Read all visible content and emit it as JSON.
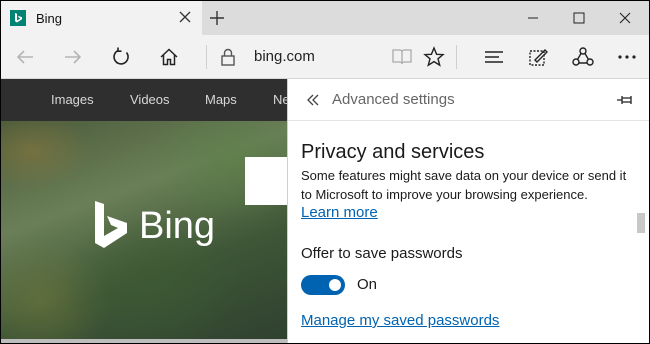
{
  "tab": {
    "title": "Bing",
    "favicon": "bing-favicon"
  },
  "toolbar": {
    "address": "bing.com"
  },
  "bing": {
    "nav": [
      "Images",
      "Videos",
      "Maps",
      "Ne"
    ],
    "logo_text": "Bing"
  },
  "panel": {
    "title": "Advanced settings",
    "section_title": "Privacy and services",
    "description": "Some features might save data on your device or send it to Microsoft to improve your browsing experience.",
    "learn_more": "Learn more",
    "option_label": "Offer to save passwords",
    "toggle_state": "On",
    "manage_link": "Manage my saved passwords"
  },
  "colors": {
    "accent": "#0063b1",
    "bing_favicon": "#008373"
  }
}
